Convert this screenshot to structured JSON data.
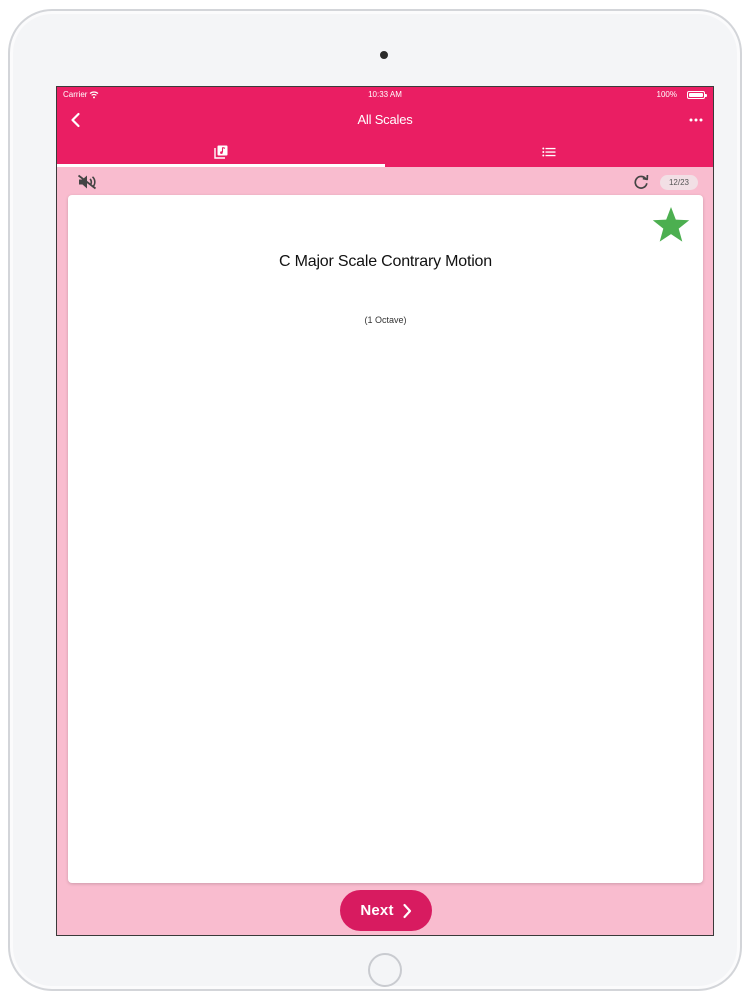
{
  "status_bar": {
    "carrier": "Carrier",
    "time": "10:33 AM",
    "battery": "100%"
  },
  "nav": {
    "title": "All Scales",
    "back_icon": "chevron-left-icon",
    "more_icon": "more-horizontal-icon"
  },
  "tabs": [
    {
      "icon": "music-card-icon",
      "selected": true
    },
    {
      "icon": "list-icon",
      "selected": false
    }
  ],
  "toolbar": {
    "mute_icon": "volume-off-icon",
    "refresh_icon": "refresh-icon",
    "counter": "12/23"
  },
  "card": {
    "title": "C Major Scale Contrary Motion",
    "subtitle": "(1 Octave)",
    "favorite_icon": "star-icon",
    "favorite_color": "#4caf50"
  },
  "footer": {
    "next_label": "Next",
    "next_icon": "chevron-right-icon"
  },
  "colors": {
    "primary": "#ea1e63",
    "background": "#f9bccf",
    "button": "#d81b60",
    "card": "#ffffff"
  }
}
